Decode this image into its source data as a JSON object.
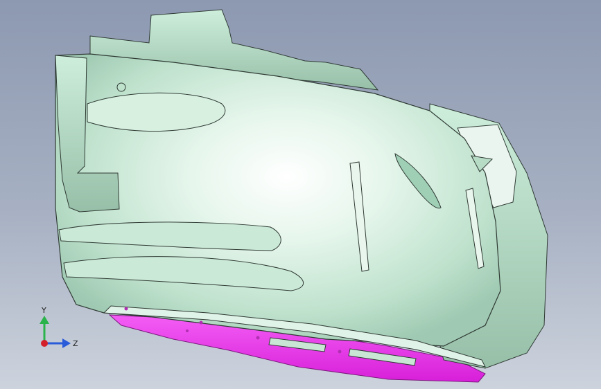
{
  "viewport": {
    "background_top": "#8d99b1",
    "background_bottom": "#cdd3dd",
    "model_color": "#bfe6cf",
    "model_highlight": "#ffffff",
    "model_edge": "#2f3a34",
    "bottom_panel_color": "#ee3cf0"
  },
  "triad": {
    "y_label": "Y",
    "z_label": "Z",
    "y_color": "#2ab34a",
    "z_color": "#2a5bd8",
    "x_color": "#d4202a"
  }
}
